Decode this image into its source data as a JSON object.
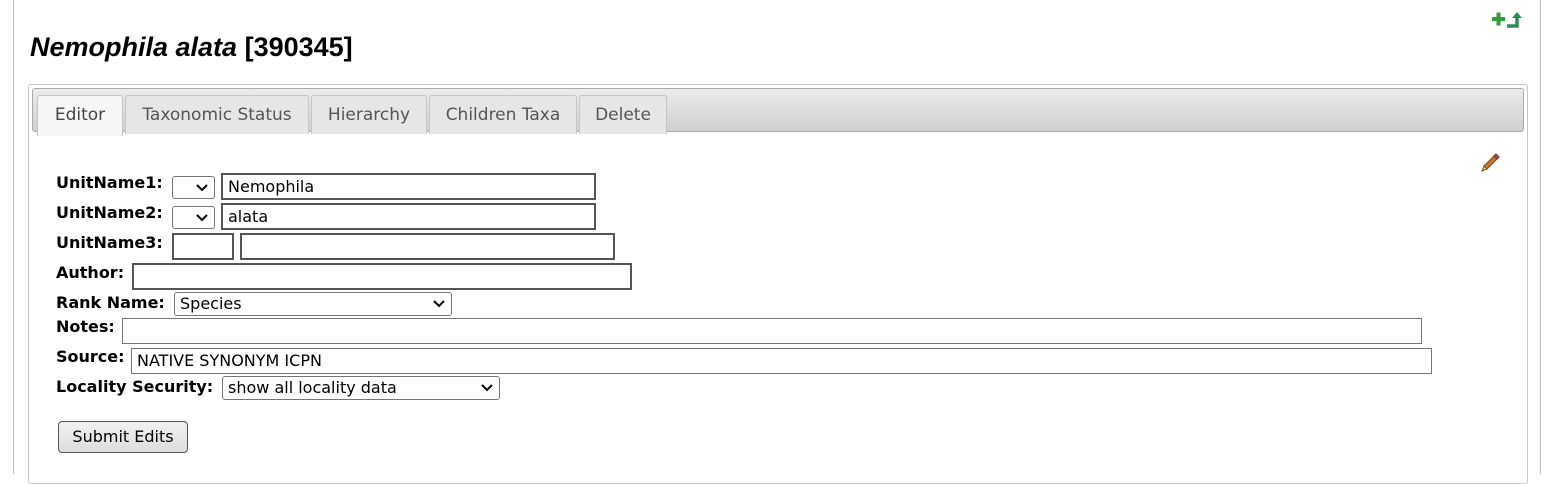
{
  "header": {
    "taxon_name": "Nemophila alata",
    "tid_label": "[390345]"
  },
  "header_icons": [
    "add-icon",
    "return-icon"
  ],
  "tabs": [
    {
      "label": "Editor",
      "active": true
    },
    {
      "label": "Taxonomic Status",
      "active": false
    },
    {
      "label": "Hierarchy",
      "active": false
    },
    {
      "label": "Children Taxa",
      "active": false
    },
    {
      "label": "Delete",
      "active": false
    }
  ],
  "form": {
    "unitname1_label": "UnitName1:",
    "unitname1_value": "Nemophila",
    "unitname2_label": "UnitName2:",
    "unitname2_value": "alata",
    "unitname3_label": "UnitName3:",
    "unitname3_value": "",
    "author_label": "Author:",
    "author_value": "",
    "rank_label": "Rank Name:",
    "rank_value": "Species",
    "notes_label": "Notes:",
    "notes_value": "",
    "source_label": "Source:",
    "source_value": "NATIVE SYNONYM ICPN",
    "security_label": "Locality Security:",
    "security_value": "show all locality data",
    "submit_label": "Submit Edits"
  },
  "colors": {
    "accent_green": "#2e9e3e",
    "tab_bar": "#d8d8d8"
  }
}
